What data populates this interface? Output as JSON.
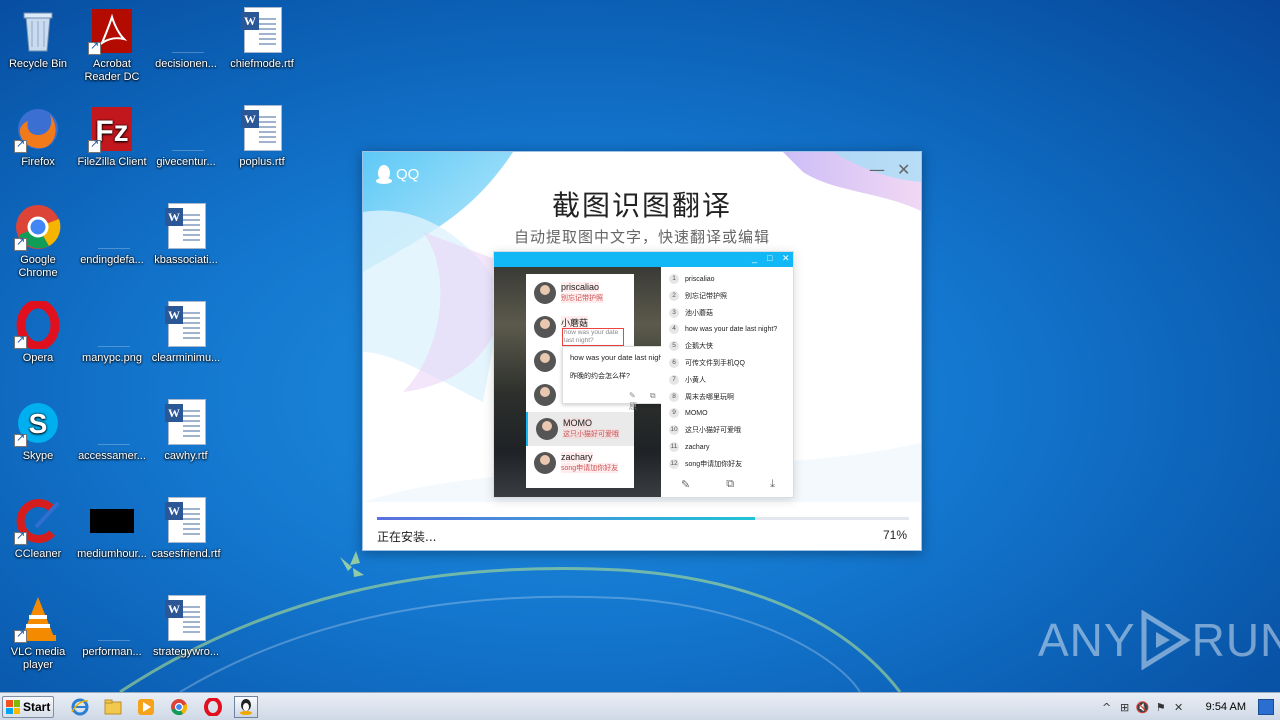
{
  "desktop": {
    "icons": [
      {
        "label": "Recycle Bin",
        "icon": "recycle-bin-icon"
      },
      {
        "label": "Acrobat Reader DC",
        "icon": "acrobat-icon"
      },
      {
        "label": "decisionen...",
        "icon": "blank-file-icon"
      },
      {
        "label": "chiefmode.rtf",
        "icon": "word-doc-icon"
      },
      {
        "label": "Firefox",
        "icon": "firefox-icon"
      },
      {
        "label": "FileZilla Client",
        "icon": "filezilla-icon"
      },
      {
        "label": "givecentur...",
        "icon": "blank-file-icon"
      },
      {
        "label": "poplus.rtf",
        "icon": "word-doc-icon"
      },
      {
        "label": "Google Chrome",
        "icon": "chrome-icon"
      },
      {
        "label": "endingdefa...",
        "icon": "blank-file-icon"
      },
      {
        "label": "kbassociati...",
        "icon": "word-doc-icon"
      },
      {
        "label": "Opera",
        "icon": "opera-icon"
      },
      {
        "label": "manypc.png",
        "icon": "blank-file-icon"
      },
      {
        "label": "clearminimu...",
        "icon": "word-doc-icon"
      },
      {
        "label": "Skype",
        "icon": "skype-icon"
      },
      {
        "label": "accessamer...",
        "icon": "blank-file-icon"
      },
      {
        "label": "cawhy.rtf",
        "icon": "word-doc-icon"
      },
      {
        "label": "CCleaner",
        "icon": "ccleaner-icon"
      },
      {
        "label": "mediumhour...",
        "icon": "image-file-icon"
      },
      {
        "label": "casesfriend.rtf",
        "icon": "word-doc-icon"
      },
      {
        "label": "VLC media player",
        "icon": "vlc-icon"
      },
      {
        "label": "performan...",
        "icon": "blank-file-icon"
      },
      {
        "label": "strategywro...",
        "icon": "word-doc-icon"
      }
    ]
  },
  "installer": {
    "logo_text": "QQ",
    "minimize_glyph": "—",
    "close_glyph": "✕",
    "title": "截图识图翻译",
    "subtitle": "自动提取图中文字，快速翻译或编辑",
    "status": "正在安装...",
    "progress_percent": 71,
    "progress_label": "71%",
    "preview": {
      "window_controls": [
        "_",
        "□",
        "✕"
      ],
      "chats": [
        {
          "name": "priscaliao",
          "message": "别忘记带护照"
        },
        {
          "name": "小蘑菇",
          "message": ""
        },
        {
          "name": "",
          "message": ""
        },
        {
          "name": "",
          "message": ""
        },
        {
          "name": "MOMO",
          "message": "这只小猫好可爱哦"
        },
        {
          "name": "zachary",
          "message": "song申请加你好友"
        }
      ],
      "red_frame_text": "how was your date last night?",
      "tooltip_line1": "how was your date last night?",
      "tooltip_line2": "昨晚的约会怎么样?",
      "tooltip_tools": "✎ ⧉ 原",
      "ocr_list": [
        {
          "num": "1",
          "text": "priscaliao"
        },
        {
          "num": "2",
          "text": "别忘记带护照"
        },
        {
          "num": "3",
          "text": "池小蘑菇"
        },
        {
          "num": "4",
          "text": "how was your date last night?"
        },
        {
          "num": "5",
          "text": "企鹅大侠"
        },
        {
          "num": "6",
          "text": "可传文件到手机QQ"
        },
        {
          "num": "7",
          "text": "小黄人"
        },
        {
          "num": "8",
          "text": "周末去哪里玩啊"
        },
        {
          "num": "9",
          "text": "MOMO"
        },
        {
          "num": "10",
          "text": "这只小猫好可爱哦"
        },
        {
          "num": "11",
          "text": "zachary"
        },
        {
          "num": "12",
          "text": "song申请加你好友"
        }
      ],
      "list_tools": [
        "✎",
        "⧉",
        "⤓"
      ]
    }
  },
  "watermark": {
    "left": "ANY",
    "right": "RUN"
  },
  "taskbar": {
    "start_label": "Start",
    "pinned": [
      "ie-icon",
      "explorer-icon",
      "media-player-icon",
      "chrome-icon",
      "opera-icon",
      "qq-installer-icon"
    ],
    "tray_icons": [
      "^",
      "⊞",
      "🔇",
      "⚑",
      "✕"
    ],
    "clock": "9:54 AM"
  },
  "colors": {
    "accent": "#12b7f5",
    "progress_start": "#5b6fe0",
    "progress_end": "#21c3d6"
  }
}
